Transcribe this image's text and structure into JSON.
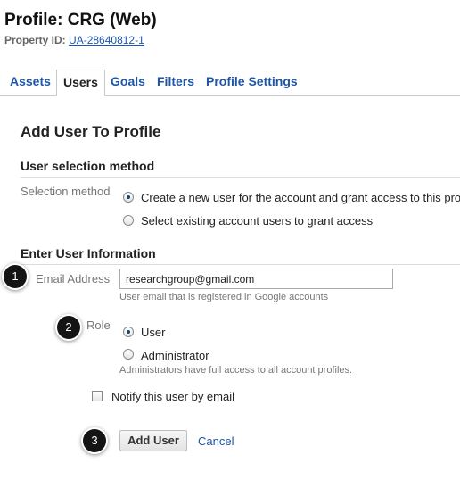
{
  "header": {
    "title": "Profile: CRG (Web)",
    "property_label": "Property ID:",
    "property_id": "UA-28640812-1"
  },
  "tabs": [
    {
      "label": "Assets",
      "active": false
    },
    {
      "label": "Users",
      "active": true
    },
    {
      "label": "Goals",
      "active": false
    },
    {
      "label": "Filters",
      "active": false
    },
    {
      "label": "Profile Settings",
      "active": false
    }
  ],
  "form": {
    "heading": "Add User To Profile",
    "selection_section": "User selection method",
    "selection_label": "Selection method",
    "selection_options": [
      {
        "label": "Create a new user for the account and grant access to this profile",
        "selected": true
      },
      {
        "label": "Select existing account users to grant access",
        "selected": false
      }
    ],
    "info_section": "Enter User Information",
    "email_label": "Email Address",
    "email_value": "researchgroup@gmail.com",
    "email_help": "User email that is registered in Google accounts",
    "role_label": "Role",
    "role_options": [
      {
        "label": "User",
        "selected": true
      },
      {
        "label": "Administrator",
        "selected": false
      }
    ],
    "role_help": "Administrators have full access to all account profiles.",
    "notify_label": "Notify this user by email",
    "notify_checked": false,
    "add_button": "Add User",
    "cancel_link": "Cancel"
  },
  "callouts": [
    "1",
    "2",
    "3"
  ],
  "colors": {
    "link": "#1f55a6",
    "callout_bg": "#141414",
    "radio_selected": "#1d3f73"
  }
}
